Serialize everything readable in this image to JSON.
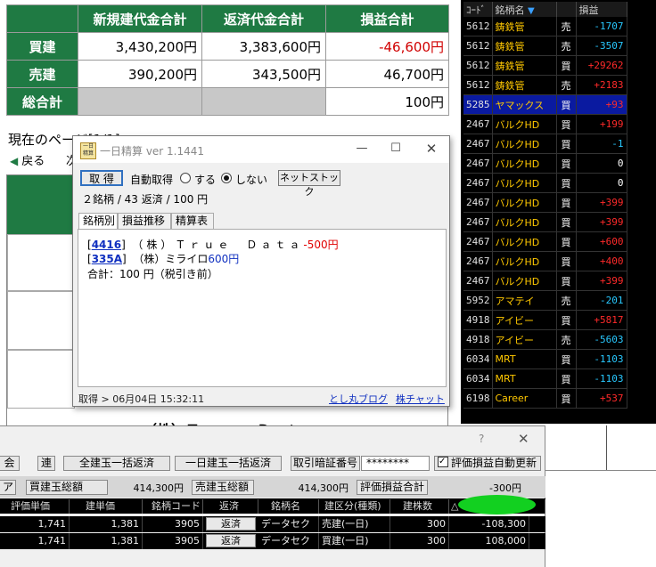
{
  "summary": {
    "headers": [
      "新規建代金合計",
      "返済代金合計",
      "損益合計"
    ],
    "rows": [
      {
        "label": "買建",
        "new": "3,430,200円",
        "repay": "3,383,600円",
        "pl": "-46,600円",
        "pl_negative": true
      },
      {
        "label": "売建",
        "new": "390,200円",
        "repay": "343,500円",
        "pl": "46,700円",
        "pl_negative": false
      },
      {
        "label": "総合計",
        "new": "",
        "repay": "",
        "pl": "100円",
        "pl_negative": false
      }
    ]
  },
  "page_nav": {
    "current": "現在のページ[1/1]",
    "back": "戻る",
    "next": "次"
  },
  "background_fragment": "（株）Ｔｒｕｅ　Ｄａｔａ",
  "stock_list": {
    "headers": {
      "code": "ｺｰﾄﾞ",
      "name": "銘柄名",
      "side": "",
      "pl": "損益"
    },
    "rows": [
      {
        "code": "5612",
        "name": "鋳鉄管",
        "side": "売",
        "pl": "-1707",
        "sign": "neg"
      },
      {
        "code": "5612",
        "name": "鋳鉄管",
        "side": "売",
        "pl": "-3507",
        "sign": "neg"
      },
      {
        "code": "5612",
        "name": "鋳鉄管",
        "side": "買",
        "pl": "+29262",
        "sign": "pos"
      },
      {
        "code": "5612",
        "name": "鋳鉄管",
        "side": "売",
        "pl": "+2183",
        "sign": "pos"
      },
      {
        "code": "5285",
        "name": "ヤマックス",
        "side": "買",
        "pl": "+93",
        "sign": "pos",
        "selected": true
      },
      {
        "code": "2467",
        "name": "バルクHD",
        "side": "買",
        "pl": "+199",
        "sign": "pos"
      },
      {
        "code": "2467",
        "name": "バルクHD",
        "side": "買",
        "pl": "-1",
        "sign": "neg"
      },
      {
        "code": "2467",
        "name": "バルクHD",
        "side": "買",
        "pl": "0",
        "sign": "zero"
      },
      {
        "code": "2467",
        "name": "バルクHD",
        "side": "買",
        "pl": "0",
        "sign": "zero"
      },
      {
        "code": "2467",
        "name": "バルクHD",
        "side": "買",
        "pl": "+399",
        "sign": "pos"
      },
      {
        "code": "2467",
        "name": "バルクHD",
        "side": "買",
        "pl": "+399",
        "sign": "pos"
      },
      {
        "code": "2467",
        "name": "バルクHD",
        "side": "買",
        "pl": "+600",
        "sign": "pos"
      },
      {
        "code": "2467",
        "name": "バルクHD",
        "side": "買",
        "pl": "+400",
        "sign": "pos"
      },
      {
        "code": "2467",
        "name": "バルクHD",
        "side": "買",
        "pl": "+399",
        "sign": "pos"
      },
      {
        "code": "5952",
        "name": "アマテイ",
        "side": "売",
        "pl": "-201",
        "sign": "neg"
      },
      {
        "code": "4918",
        "name": "アイビー",
        "side": "買",
        "pl": "+5817",
        "sign": "pos"
      },
      {
        "code": "4918",
        "name": "アイビー",
        "side": "売",
        "pl": "-5603",
        "sign": "neg"
      },
      {
        "code": "6034",
        "name": "MRT",
        "side": "買",
        "pl": "-1103",
        "sign": "neg"
      },
      {
        "code": "6034",
        "name": "MRT",
        "side": "買",
        "pl": "-1103",
        "sign": "neg"
      },
      {
        "code": "6198",
        "name": "Career",
        "side": "買",
        "pl": "+537",
        "sign": "pos"
      }
    ]
  },
  "dialog": {
    "icon_text": "一日精算",
    "title": "一日精算 ver 1.1441",
    "fetch_button": "取 得",
    "auto_fetch_label": "自動取得",
    "radio_on_label": "する",
    "radio_off_label": "しない",
    "netstock_button": "ネットストック",
    "summary_line": "２銘柄 / 43 返済 / 100 円",
    "tabs": [
      "銘柄別",
      "損益推移",
      "精算表"
    ],
    "entries": [
      {
        "code": "4416",
        "name": "（株）Ｔｒｕｅ　Ｄａｔａ",
        "pl": "-500円",
        "negative": true
      },
      {
        "code": "335A",
        "name": "（株）ミライロ",
        "pl": "600円",
        "negative": false
      }
    ],
    "total_line": "合計：100 円（税引き前）",
    "status": "取得 > 06月04日 15:32:11",
    "blog_link": "とし丸ブログ",
    "chart_link": "株チャット"
  },
  "trade": {
    "help": "?",
    "close": "✕",
    "tab_fragment": "会",
    "ren_button": "連",
    "all_build_button": "全建玉一括返済",
    "day_all_button": "一日建玉一括返済",
    "pin_label": "取引暗証番号",
    "pin_value": "********",
    "auto_eval_label": "評価損益自動更新",
    "a_fragment": "ア",
    "buy_total_label": "買建玉総額",
    "buy_total_value": "414,300円",
    "sell_total_label": "売建玉総額",
    "sell_total_value": "414,300円",
    "eval_total_label": "評価損益合計",
    "eval_total_value": "-300円",
    "columns": [
      "評価単価",
      "建単価",
      "銘柄コード",
      "返済",
      "銘柄名",
      "建区分(種類)",
      "建株数",
      "△"
    ],
    "rows": [
      {
        "eval_price": "1,741",
        "build_price": "1,381",
        "code": "3905",
        "repay": "返済",
        "name": "データセク",
        "kind": "売建(一日)",
        "qty": "300",
        "pl": "-108,300"
      },
      {
        "eval_price": "1,741",
        "build_price": "1,381",
        "code": "3905",
        "repay": "返済",
        "name": "データセク",
        "kind": "買建(一日)",
        "qty": "300",
        "pl": "108,000"
      }
    ]
  }
}
